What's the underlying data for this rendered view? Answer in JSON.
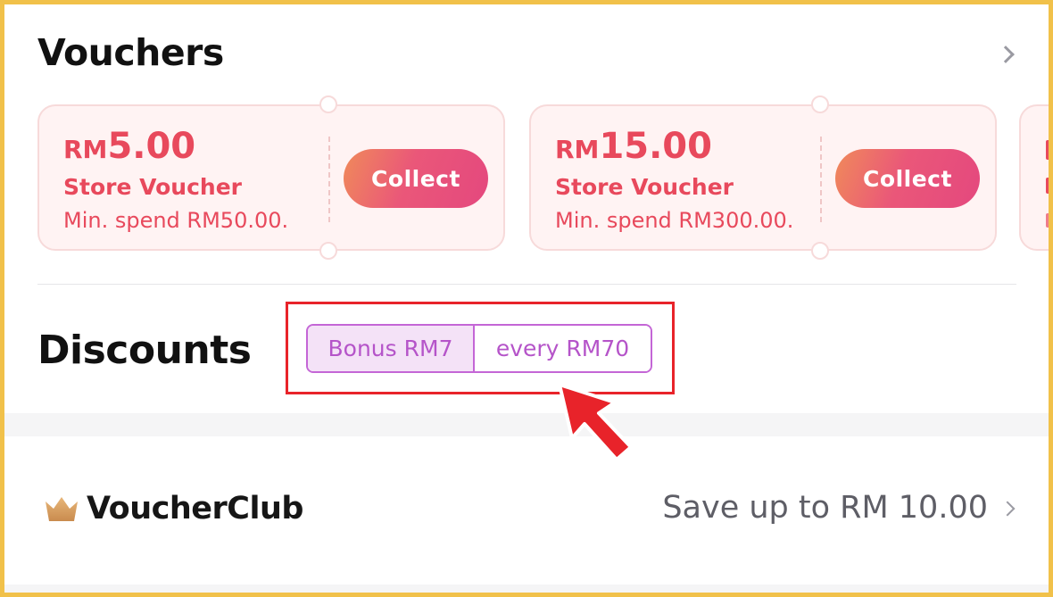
{
  "vouchers": {
    "title": "Vouchers",
    "items": [
      {
        "currency": "RM",
        "amount": "5.00",
        "type": "Store Voucher",
        "min_spend": "Min. spend RM50.00.",
        "button": "Collect"
      },
      {
        "currency": "RM",
        "amount": "15.00",
        "type": "Store Voucher",
        "min_spend": "Min. spend RM300.00.",
        "button": "Collect"
      }
    ]
  },
  "discounts": {
    "title": "Discounts",
    "tag_left": "Bonus RM7",
    "tag_right": "every RM70"
  },
  "voucher_club": {
    "name": "VoucherClub",
    "save_text": "Save up to RM 10.00"
  },
  "colors": {
    "accent_red": "#e8495c",
    "tag_purple": "#b554c9",
    "highlight_red": "#e8232a",
    "frame_yellow": "#f1c14a"
  },
  "icons": [
    "chevron-right-icon",
    "crown-icon",
    "cursor-arrow-icon"
  ]
}
